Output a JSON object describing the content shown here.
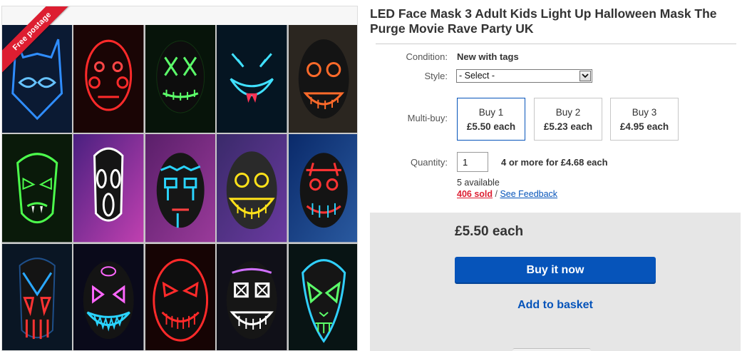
{
  "listing": {
    "title": "LED Face Mask 3 Adult Kids Light Up Halloween Mask The Purge Movie Rave Party UK",
    "ribbon": "Free postage"
  },
  "details": {
    "condition_label": "Condition:",
    "condition_value": "New with tags",
    "style_label": "Style:",
    "style_selected": "- Select -",
    "multibuy_label": "Multi-buy:",
    "multibuy_options": [
      {
        "qty": "Buy 1",
        "price": "£5.50 each"
      },
      {
        "qty": "Buy 2",
        "price": "£5.23 each"
      },
      {
        "qty": "Buy 3",
        "price": "£4.95 each"
      }
    ],
    "quantity_label": "Quantity:",
    "quantity_value": "1",
    "quantity_deal": "4 or more for £4.68 each",
    "available": "5 available",
    "sold": "406 sold",
    "separator": " / ",
    "feedback": "See Feedback"
  },
  "buy_box": {
    "price": "£5.50 each",
    "buy_now": "Buy it now",
    "add_to_basket": "Add to basket"
  },
  "colors": {
    "brand_blue": "#0654ba",
    "ribbon_red": "#dd1e31",
    "buy_box_bg": "#e6e6e6"
  },
  "icons": {
    "select_caret": "chevron-down-icon"
  }
}
